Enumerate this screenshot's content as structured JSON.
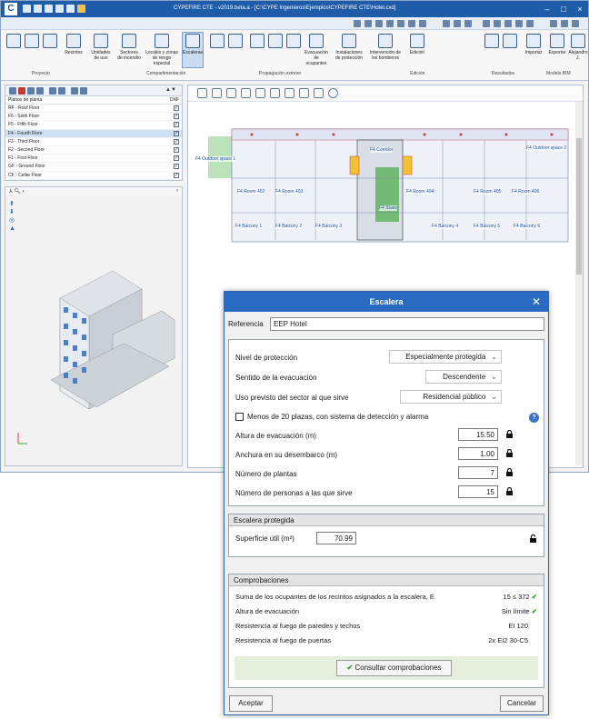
{
  "app": {
    "logo": "C",
    "window_title": "CYPEFIRE CTE - v2019.beta.a - [C:\\CYPE Ingenieros\\Ejemplos\\CYPEFIRE CTE\\Hotel.cxd]"
  },
  "ribbon": {
    "buttons": [
      {
        "label": "Recintos"
      },
      {
        "label": "Unidades\nde uso"
      },
      {
        "label": "Sectores\nde incendio"
      },
      {
        "label": "Locales y zonas\nde riesgo especial"
      },
      {
        "label": "Escaleras"
      },
      {
        "label": "Evacuación\nde ocupantes"
      },
      {
        "label": "Instalaciones\nde protección"
      },
      {
        "label": "Intervención de\nlos bomberos"
      },
      {
        "label": "Edición"
      },
      {
        "label": "Importar"
      },
      {
        "label": "Exportar"
      },
      {
        "label": "Alejandro\nJ."
      }
    ],
    "groups": {
      "proyecto": "Proyecto",
      "compartimentacion": "Compartimentación",
      "propagacion": "Propagación exterior",
      "edicion": "Edición",
      "resultados": "Resultados",
      "modelo_bim": "Modelo BIM"
    }
  },
  "floors": {
    "header": "Planos de planta",
    "header_right": "DXF",
    "items": [
      {
        "name": "RF - Roof Floor",
        "checked": true
      },
      {
        "name": "F6 - Sixth Floor",
        "checked": true
      },
      {
        "name": "F5 - Fifth Floor",
        "checked": true
      },
      {
        "name": "F4 - Fourth Floor",
        "checked": true,
        "selected": true
      },
      {
        "name": "F3 - Third Floor",
        "checked": true
      },
      {
        "name": "F2 - Second Floor",
        "checked": true
      },
      {
        "name": "F1 - First Floor",
        "checked": true
      },
      {
        "name": "GF - Ground Floor",
        "checked": true
      },
      {
        "name": "CF - Cellar Floor",
        "checked": true
      }
    ]
  },
  "plan": {
    "labels": [
      "F4 Corridor",
      "F4 Outdoor space 1",
      "F4 Outdoor space 2",
      "F4 Room 402",
      "F4 Room 403",
      "F4 Room 404",
      "F4 Room 405",
      "F4 Room 406",
      "F4 Stairs",
      "F4 Balcony 1",
      "F4 Balcony 2",
      "F4 Balcony 3",
      "F4 Balcony 4",
      "F4 Balcony 5",
      "F4 Balcony 6"
    ]
  },
  "dialog": {
    "title": "Escalera",
    "reference_label": "Referencia",
    "reference_value": "EEP Hotel",
    "fields": {
      "nivel_label": "Nivel de protección",
      "nivel_value": "Especialmente protegida",
      "sentido_label": "Sentido de la evacuación",
      "sentido_value": "Descendente",
      "uso_label": "Uso previsto del sector al que sirve",
      "uso_value": "Residencial público",
      "menos20_label": "Menos de 20 plazas, con sistema de detección y alarma",
      "altura_label": "Altura de evacuación (m)",
      "altura_value": "15.50",
      "anchura_label": "Anchura en su desembarco (m)",
      "anchura_value": "1.00",
      "plantas_label": "Número de plantas",
      "plantas_value": "7",
      "personas_label": "Número de personas a las que sirve",
      "personas_value": "15"
    },
    "protegida": {
      "header": "Escalera protegida",
      "superficie_label": "Superficie útil (m²)",
      "superficie_value": "70.99"
    },
    "comprobaciones": {
      "header": "Comprobaciones",
      "rows": [
        {
          "label": "Suma de los ocupantes de los recintos asignados a la escalera, E",
          "value": "15 ≤ 372",
          "ok": true
        },
        {
          "label": "Altura de evacuación",
          "value": "Sin límite",
          "ok": true
        },
        {
          "label": "Resistencia al fuego de paredes y techos",
          "value": "EI 120",
          "ok": false
        },
        {
          "label": "Resistencia al fuego de puertas",
          "value": "2x EI2 30-C5",
          "ok": false
        }
      ],
      "consult_button": "Consultar comprobaciones"
    },
    "accept_button": "Aceptar",
    "cancel_button": "Cancelar"
  },
  "colors": {
    "titlebar": "#1e5ba8",
    "dialog_title": "#2a6cc4",
    "ok_check": "#2fa02f",
    "floor_selected": "#cfe0f5",
    "stairs_highlight": "#4aa04a"
  }
}
